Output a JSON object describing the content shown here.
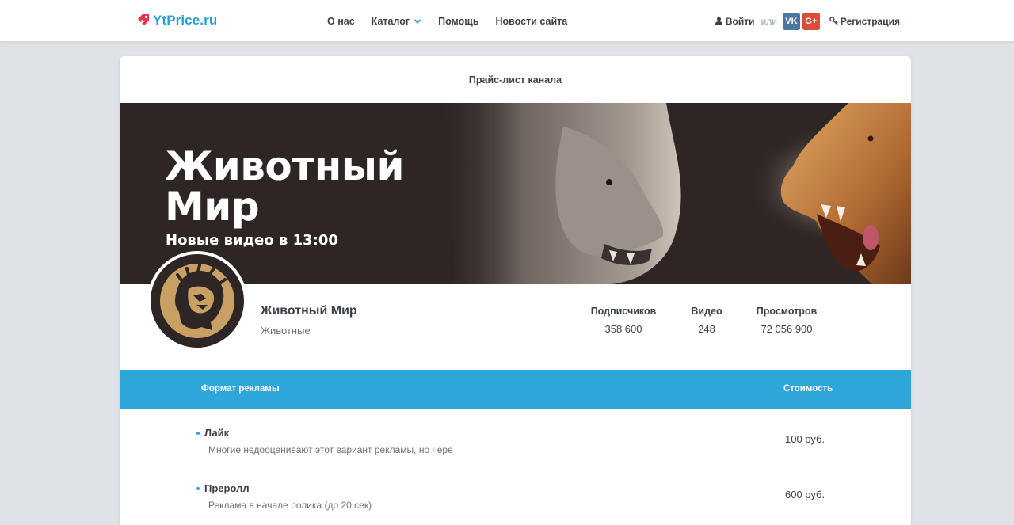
{
  "header": {
    "logo": "YtPrice.ru",
    "nav": [
      {
        "label": "О нас"
      },
      {
        "label": "Каталог"
      },
      {
        "label": "Помощь"
      },
      {
        "label": "Новости сайта"
      }
    ],
    "login": "Войти",
    "or": "или",
    "vk": "VK",
    "gplus": "G+",
    "register": "Регистрация"
  },
  "card": {
    "title": "Прайс-лист канала"
  },
  "banner": {
    "line1": "Животный",
    "line2": "Мир",
    "subtitle": "Новые видео в 13:00"
  },
  "channel": {
    "name": "Животный Мир",
    "category": "Животные",
    "stats": [
      {
        "label": "Подписчиков",
        "value": "358 600"
      },
      {
        "label": "Видео",
        "value": "248"
      },
      {
        "label": "Просмотров",
        "value": "72 056 900"
      }
    ]
  },
  "pricing": {
    "col_format": "Формат рекламы",
    "col_price": "Стоимость",
    "rows": [
      {
        "name": "Лайк",
        "desc": "Многие недооценивают этот вариант рекламы, но чере",
        "price": "100 руб."
      },
      {
        "name": "Преролл",
        "desc": "Реклама в начале ролика (до 20 сек)",
        "price": "600 руб."
      }
    ]
  },
  "colors": {
    "accent": "#2ea6da",
    "logo_red": "#e8334a",
    "vk": "#4c75a3",
    "gplus": "#dd4b39",
    "page_bg": "#dfe3e7"
  }
}
